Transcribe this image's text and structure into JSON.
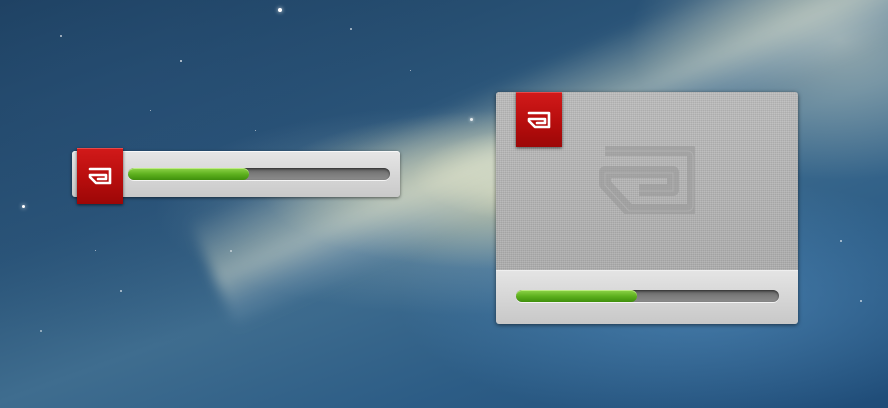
{
  "desktop": {
    "wallpaper": "galaxy-wallpaper"
  },
  "widgets": {
    "small": {
      "icon": "app-logo-icon",
      "progress": 0.46
    },
    "large": {
      "icon": "app-logo-icon",
      "watermark_icon": "app-logo-watermark",
      "progress": 0.46
    }
  },
  "colors": {
    "ribbon_red": "#c01212",
    "progress_green": "#5fb21f",
    "panel_gray": "#b5b5b5"
  }
}
